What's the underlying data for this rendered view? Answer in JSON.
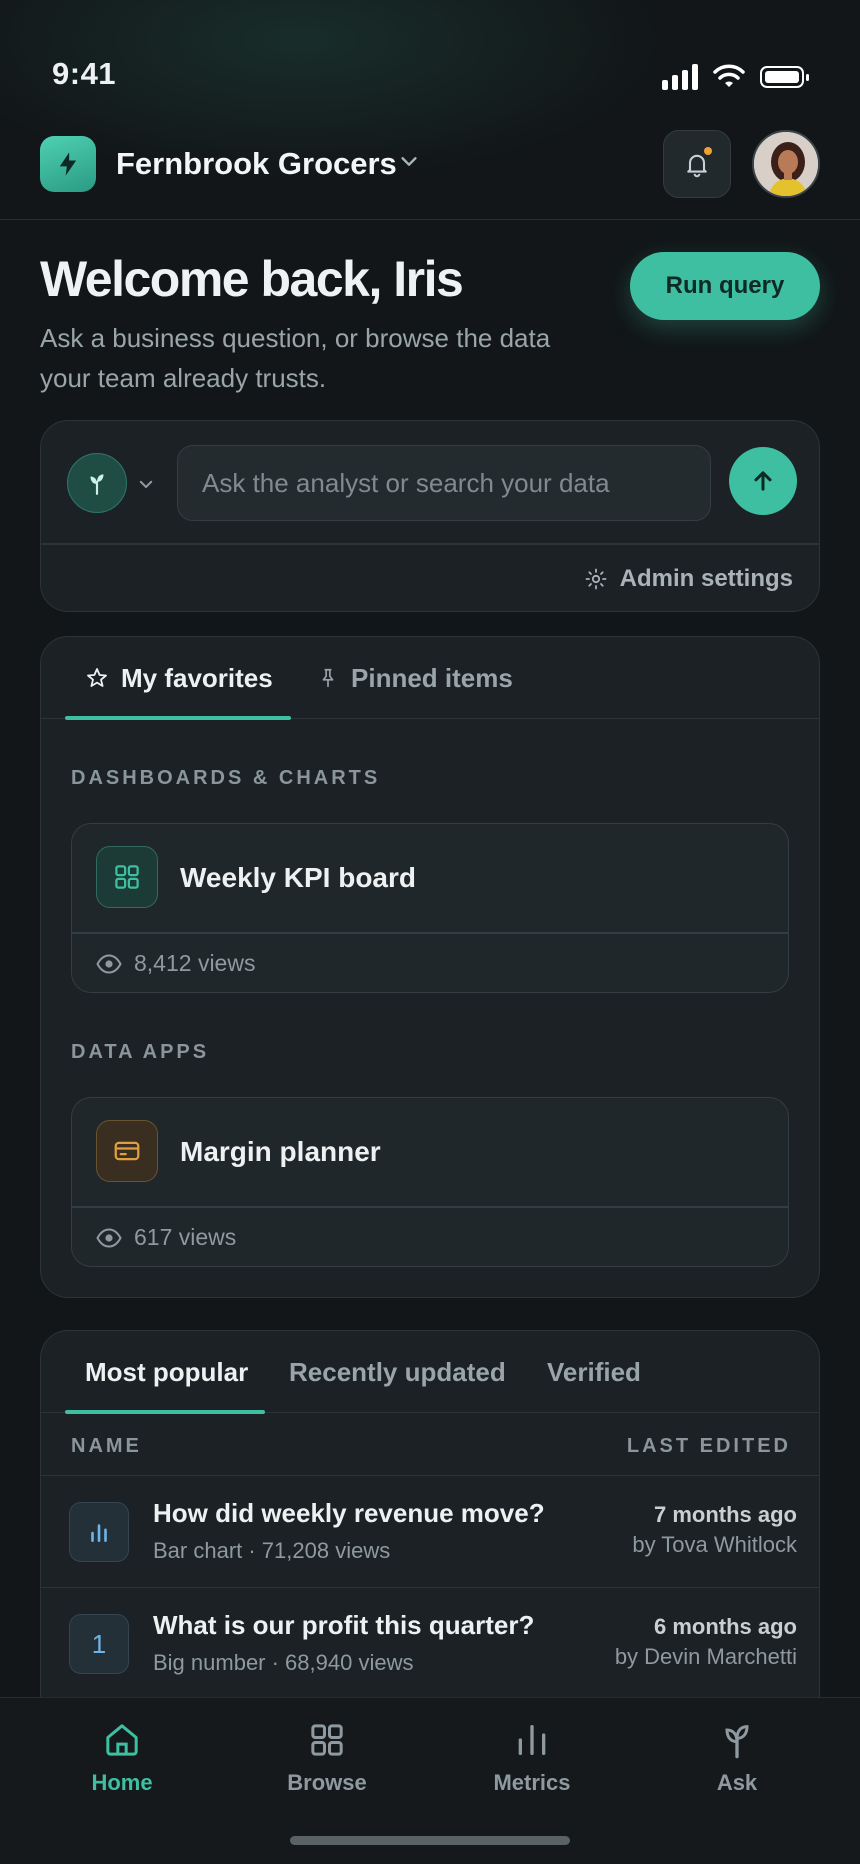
{
  "status_bar": {
    "time": "9:41",
    "icons": [
      "signal-icon",
      "wifi-icon",
      "battery-icon"
    ]
  },
  "header": {
    "workspace_name": "Fernbrook Grocers",
    "logo_icon": "bolt-icon",
    "notification_icon": "bell-icon",
    "has_unread": true
  },
  "welcome": {
    "title": "Welcome back, Iris",
    "subtitle": "Ask a business question, or browse the data your team already trusts.",
    "run_query_label": "Run query"
  },
  "ask": {
    "placeholder": "Ask the analyst or search your data",
    "value": "",
    "admin_label": "Admin settings"
  },
  "favorites": {
    "tabs": [
      {
        "label": "My favorites",
        "icon": "star-icon",
        "active": true
      },
      {
        "label": "Pinned items",
        "icon": "pin-icon",
        "active": false
      }
    ],
    "sections": [
      {
        "label": "DASHBOARDS & CHARTS",
        "item": {
          "title": "Weekly KPI board",
          "views": "8,412 views",
          "icon": "grid-icon"
        }
      },
      {
        "label": "DATA APPS",
        "item": {
          "title": "Margin planner",
          "views": "617 views",
          "icon": "card-icon"
        }
      }
    ]
  },
  "popular": {
    "tabs": [
      {
        "label": "Most popular",
        "active": true
      },
      {
        "label": "Recently updated",
        "active": false
      },
      {
        "label": "Verified",
        "active": false
      }
    ],
    "columns": {
      "name": "NAME",
      "last_edited": "LAST EDITED"
    },
    "rows": [
      {
        "title": "How did weekly revenue move?",
        "meta": "Bar chart · 71,208 views",
        "when": "7 months ago",
        "by": "by Tova Whitlock",
        "icon": "bar-chart-icon",
        "icon_text": ""
      },
      {
        "title": "What is our profit this quarter?",
        "meta": "Big number · 68,940 views",
        "when": "6 months ago",
        "by": "by Devin Marchetti",
        "icon": "number-icon",
        "icon_text": "1"
      }
    ]
  },
  "nav": {
    "items": [
      {
        "label": "Home",
        "icon": "home-icon",
        "active": true
      },
      {
        "label": "Browse",
        "icon": "grid-icon",
        "active": false
      },
      {
        "label": "Metrics",
        "icon": "metrics-icon",
        "active": false
      },
      {
        "label": "Ask",
        "icon": "sprout-icon",
        "active": false
      }
    ]
  },
  "colors": {
    "accent": "#3fbfa2",
    "background": "#121618",
    "card": "#1b2124",
    "notification_dot": "#f0a030",
    "app_icon": "#e0a040"
  }
}
